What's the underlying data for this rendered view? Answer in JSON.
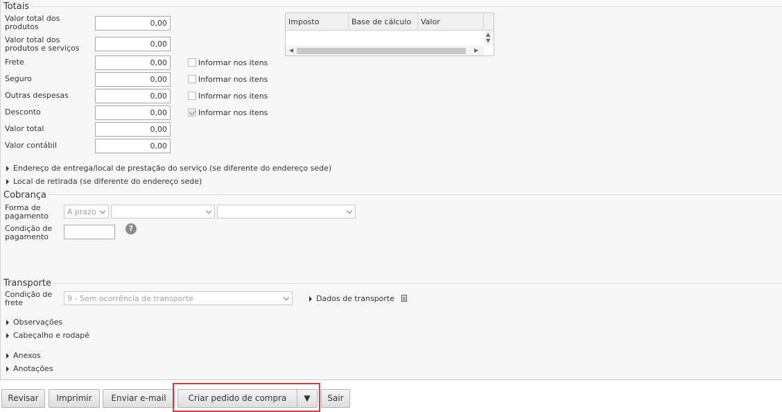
{
  "totais": {
    "title": "Totais",
    "rows": [
      {
        "label": "Valor total dos produtos",
        "value": "0,00"
      },
      {
        "label": "Valor total dos produtos e serviços",
        "value": "0,00"
      },
      {
        "label": "Frete",
        "value": "0,00",
        "checkbox_label": "Informar nos itens",
        "checked": false
      },
      {
        "label": "Seguro",
        "value": "0,00",
        "checkbox_label": "Informar nos itens",
        "checked": false
      },
      {
        "label": "Outras despesas",
        "value": "0,00",
        "checkbox_label": "Informar nos itens",
        "checked": false
      },
      {
        "label": "Desconto",
        "value": "0,00",
        "checkbox_label": "Informar nos itens",
        "checked": true
      },
      {
        "label": "Valor total",
        "value": "0,00"
      },
      {
        "label": "Valor contábil",
        "value": "0,00"
      }
    ],
    "tax_table": {
      "columns": [
        "Imposto",
        "Base de cálculo",
        "Valor"
      ],
      "rows": []
    }
  },
  "expanders": {
    "entrega": "Endereço de entrega/local de prestação do serviço (se diferente do endereço sede)",
    "retirada": "Local de retirada (se diferente do endereço sede)",
    "observacoes": "Observações",
    "cabecalho": "Cabeçalho e rodapé",
    "anexos": "Anexos",
    "anotacoes": "Anotações"
  },
  "cobranca": {
    "title": "Cobrança",
    "forma_label": "Forma de pagamento",
    "forma_value": "A prazo",
    "forma_select2": "",
    "forma_select3": "",
    "condicao_label": "Condição de pagamento",
    "condicao_value": "",
    "help_icon": "question-mark-icon"
  },
  "transporte": {
    "title": "Transporte",
    "condicao_label": "Condição de frete",
    "condicao_value": "9 - Sem ocorrência de transporte",
    "dados_label": "Dados de transporte",
    "dados_icon": "document-icon"
  },
  "footer": {
    "revisar": "Revisar",
    "imprimir": "Imprimir",
    "enviar_email": "Enviar e-mail",
    "criar_pedido": "Criar pedido de compra",
    "criar_menu": "▼",
    "sair": "Sair"
  },
  "colors": {
    "highlight": "#e53a3a",
    "panel_bg": "#f7f7f7"
  }
}
